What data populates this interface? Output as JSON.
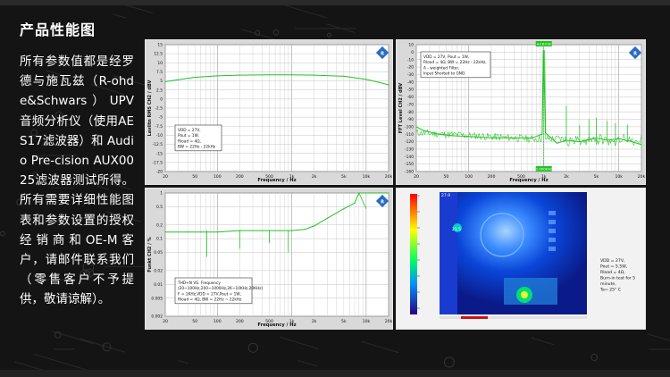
{
  "page": {
    "title": "产品性能图",
    "description": "所有参数值都是经罗德与施瓦兹（R-ohde&Schwars）UPV音频分析仪（使用AES17滤波器）和 Audio Pre-cision AUX0025滤波器测试所得。所有需要详细性能图表和参数设置的授权经销商和OE-M客户，请邮件联系我们（零售客户不予提供，敬请谅解）。"
  },
  "chart_data": [
    {
      "type": "line",
      "name": "frequency-response",
      "xlabel": "Frequency / Hz",
      "ylabel": "Lavlitn RMS  CH2 / dBV",
      "xscale": "log",
      "xlim": [
        20,
        20000
      ],
      "ylim": [
        -20,
        15
      ],
      "x_ticks": [
        "20",
        "50",
        "100",
        "200",
        "500",
        "1k",
        "2k",
        "5k",
        "10k",
        "20k"
      ],
      "y_ticks": [
        "15",
        "12.5",
        "10",
        "7.5",
        "5",
        "2.5",
        "0",
        "-2.5",
        "-5",
        "-7.5",
        "-10",
        "-12.5",
        "-15",
        "-17.5",
        "-20"
      ],
      "series": [
        {
          "color": "#22c322",
          "x": [
            20,
            50,
            100,
            200,
            500,
            1000,
            2000,
            5000,
            10000,
            15000,
            20000
          ],
          "y": [
            4.8,
            6.0,
            6.4,
            6.6,
            6.7,
            6.7,
            6.6,
            6.3,
            5.4,
            4.6,
            3.9
          ]
        }
      ],
      "annotation": [
        "VDD = 27V,",
        "Pout = 1W,",
        "Rload = 4Ω,",
        "BW = 22Hz - 22kHz"
      ],
      "grid": true
    },
    {
      "type": "line",
      "name": "fft-spectrum",
      "xlabel": "Frequency / Hz",
      "ylabel": "FFT Level  CH2 / dBV",
      "xscale": "log",
      "xlim": [
        20,
        20000
      ],
      "ylim": [
        -160,
        10
      ],
      "x_ticks": [
        "20",
        "50",
        "100",
        "200",
        "500",
        "1k",
        "2k",
        "5k",
        "10k",
        "20k"
      ],
      "y_ticks": [
        "10",
        "0",
        "-10",
        "-20",
        "-30",
        "-40",
        "-50",
        "-60",
        "-70",
        "-80",
        "-90",
        "-100",
        "-110",
        "-120",
        "-130",
        "-140",
        "-150",
        "-160"
      ],
      "cursor_top": "A3.6318",
      "cursor_bottom": "1.000kHz",
      "series": [
        {
          "color": "#22c322",
          "x": [
            20,
            25,
            40,
            60,
            100,
            200,
            400,
            700,
            950,
            1000,
            1050,
            1500,
            2000,
            3000,
            5000,
            7000,
            10000,
            14000,
            20000
          ],
          "y": [
            -100,
            -105,
            -110,
            -112,
            -113,
            -115,
            -115,
            -115,
            -110,
            2,
            -108,
            -122,
            -118,
            -120,
            -115,
            -118,
            -116,
            -119,
            -124
          ]
        }
      ],
      "annotation": [
        "VDD = 27V,  Pout = 1W,",
        "Rload = 4Ω,  BW = 22Hz - 22kHz,",
        "A - weighted Filter,",
        "Input Shorted to GND."
      ],
      "grid": true
    },
    {
      "type": "line",
      "name": "thd-n-vs-frequency",
      "xlabel": "Frequency / Hz",
      "ylabel": "Funkt CH2 / %",
      "xscale": "log",
      "xlim": [
        20,
        20000
      ],
      "ylim": [
        0.002,
        1
      ],
      "x_ticks": [
        "20",
        "50",
        "100",
        "200",
        "500",
        "1k",
        "2k",
        "5k",
        "10k",
        "20k"
      ],
      "y_ticks": [
        "1",
        "0.5",
        "0.2",
        "0.1",
        "0.05",
        "0.02",
        "0.01",
        "0.005",
        "0.002"
      ],
      "series": [
        {
          "color": "#22c322",
          "x": [
            20,
            40,
            60,
            100,
            200,
            500,
            1000,
            1500,
            2000,
            3000,
            5000,
            7000,
            8000,
            10000,
            15000,
            20000
          ],
          "y": [
            0.14,
            0.14,
            0.14,
            0.14,
            0.15,
            0.15,
            0.15,
            0.16,
            0.19,
            0.28,
            0.45,
            0.6,
            1.0,
            1.0,
            1.0,
            1.0
          ]
        }
      ],
      "annotation": [
        "THD+N VS. Frequency",
        "(20~100Hz,200~1000Hz,2K~10KHz,20KHz)",
        "F = 1KHz,VDD = 27V,Pout = 1W,",
        "Rload = 4Ω, BW = 22Hz ~ 22kHz"
      ],
      "grid": true
    }
  ],
  "thermal": {
    "marker_max": "27.9",
    "marker_min": "21.5",
    "info": [
      "VDD = 27V,",
      "Pout = 5.5W,",
      "Rload = 4Ω,",
      "Burn-in test for 5",
      "minute,",
      "Ta= 25° C"
    ],
    "colors": {
      "scale_top": "#ff0000",
      "scale_bottom": "#2a0080"
    }
  },
  "colors": {
    "background": "#161616",
    "panel": "#d9d9d9",
    "trace": "#22c322",
    "logo": "#2a6cc4"
  }
}
